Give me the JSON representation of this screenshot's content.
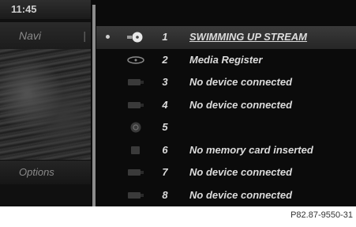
{
  "status": {
    "time": "11:45"
  },
  "sidebar": {
    "navi_label": "Navi",
    "navi_sep": "|",
    "options_label": "Options"
  },
  "media_list": [
    {
      "number": "1",
      "label": "SWIMMING UP STREAM",
      "icon": "disc-icon",
      "selected": true
    },
    {
      "number": "2",
      "label": "Media Register",
      "icon": "hdd-icon",
      "selected": false
    },
    {
      "number": "3",
      "label": "No device connected",
      "icon": "usb-icon",
      "selected": false
    },
    {
      "number": "4",
      "label": "No device connected",
      "icon": "usb-icon",
      "selected": false
    },
    {
      "number": "5",
      "label": "",
      "icon": "ipod-icon",
      "selected": false
    },
    {
      "number": "6",
      "label": "No memory card inserted",
      "icon": "memory-card-icon",
      "selected": false
    },
    {
      "number": "7",
      "label": "No device connected",
      "icon": "usb-icon",
      "selected": false
    },
    {
      "number": "8",
      "label": "No device connected",
      "icon": "usb-icon",
      "selected": false
    }
  ],
  "figure_code": "P82.87-9550-31"
}
